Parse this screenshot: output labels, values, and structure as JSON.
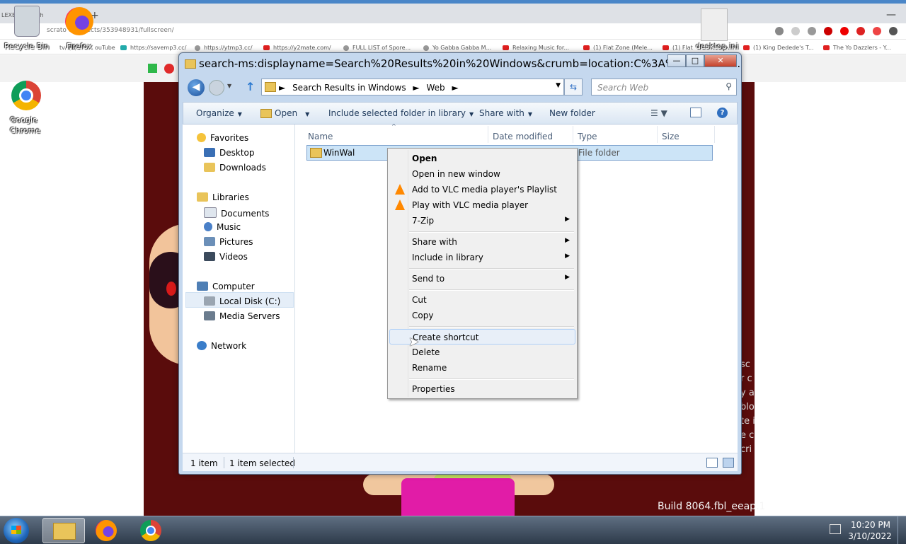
{
  "browser": {
    "tab_fragments": [
      "LEXE",
      "ch"
    ],
    "url": "scratch.mit.edu/projects/353948931/fullscreen/",
    "url_visible": "scrato          o/projects/353948931/fullscreen/",
    "bookmarks": [
      "tv/ (1) F",
      "ouTube",
      "https://savemp3.cc/",
      "https://ytmp3.cc/",
      "https://y2mate.com/",
      "FULL LIST of Spore...",
      "Yo Gabba Gabba M...",
      "Relaxing Music for...",
      "(1) Flat Zone (Mele...",
      "(1) Flat",
      "(1) King Dedede's T...",
      "The Yo Dazzlers - Y..."
    ]
  },
  "desktop": {
    "icons": [
      {
        "label": "Recycle Bin"
      },
      {
        "label": "Firefox"
      },
      {
        "label": "desktop.ini"
      },
      {
        "label_line1": "Google",
        "label_line2": "Chrome"
      }
    ]
  },
  "stage": {
    "build_text": "Build 8064.fbl_eeap.1",
    "side_fragment": [
      "sc",
      "r c",
      "y a",
      "blo",
      "te i",
      "e c",
      "cri"
    ]
  },
  "window": {
    "title": "search-ms:displayname=Search%20Results%20in%20Windows&crumb=location:C%3A%5CWindow...",
    "controls": {
      "minimize": "—",
      "maximize": "□",
      "close": "✕"
    },
    "breadcrumbs": [
      "►",
      "Search Results in Windows",
      "►",
      "Web",
      "►"
    ],
    "search_placeholder": "Search Web",
    "toolbar": {
      "organize": "Organize",
      "open": "Open",
      "include": "Include selected folder in library",
      "share": "Share with",
      "new_folder": "New folder",
      "help": "?"
    },
    "nav_pane": {
      "favorites": "Favorites",
      "desktop": "Desktop",
      "downloads": "Downloads",
      "libraries": "Libraries",
      "documents": "Documents",
      "music": "Music",
      "pictures": "Pictures",
      "videos": "Videos",
      "computer": "Computer",
      "local_disk": "Local Disk (C:)",
      "media_servers": "Media Servers",
      "network": "Network"
    },
    "columns": {
      "name": "Name",
      "date": "Date modified",
      "type": "Type",
      "size": "Size"
    },
    "rows": [
      {
        "name": "WinWal",
        "type": "File folder"
      }
    ],
    "status": {
      "count": "1 item",
      "selected": "1 item selected"
    }
  },
  "context_menu": {
    "items": [
      {
        "label": "Open"
      },
      {
        "label": "Open in new window"
      },
      {
        "label": "Add to VLC media player's Playlist"
      },
      {
        "label": "Play with VLC media player"
      },
      {
        "label": "7-Zip"
      },
      {
        "label": "Share with"
      },
      {
        "label": "Include in library"
      },
      {
        "label": "Send to"
      },
      {
        "label": "Cut"
      },
      {
        "label": "Copy"
      },
      {
        "label": "Create shortcut"
      },
      {
        "label": "Delete"
      },
      {
        "label": "Rename"
      },
      {
        "label": "Properties"
      }
    ],
    "highlighted": "Create shortcut"
  },
  "taskbar": {
    "time": "10:20 PM",
    "date": "3/10/2022"
  },
  "colors": {
    "stage_bg": "#5a0c0c",
    "selection": "#cce4f7",
    "menu_highlight": "#e8eff8",
    "taskbar": "#2d3a4a"
  }
}
